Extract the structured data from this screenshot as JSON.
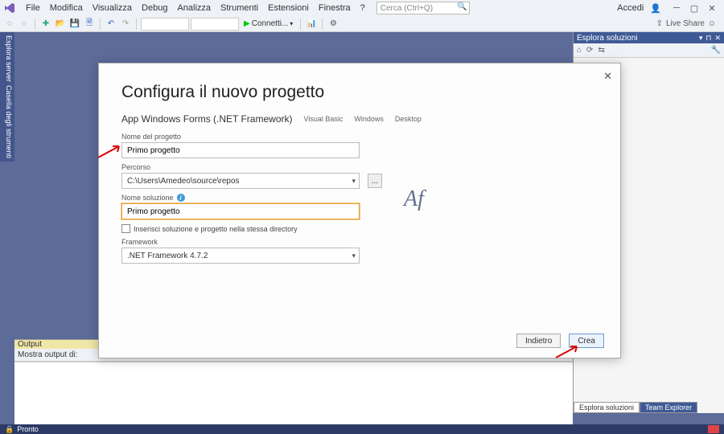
{
  "menu": {
    "items": [
      "File",
      "Modifica",
      "Visualizza",
      "Debug",
      "Analizza",
      "Strumenti",
      "Estensioni",
      "Finestra",
      "?"
    ],
    "search_placeholder": "Cerca (Ctrl+Q)",
    "accedi": "Accedi"
  },
  "toolbar": {
    "connect": "Connetti...",
    "liveshare": "Live Share"
  },
  "side_tabs": {
    "a": "Esplora server",
    "b": "Casella degli strumenti"
  },
  "solution": {
    "title": "Esplora soluzioni",
    "tabs": {
      "active": "Esplora soluzioni",
      "other": "Team Explorer"
    }
  },
  "output": {
    "title": "Output",
    "label": "Mostra output di:"
  },
  "status": {
    "ready": "Pronto"
  },
  "dialog": {
    "title": "Configura il nuovo progetto",
    "subtitle": "App Windows Forms (.NET Framework)",
    "tags": [
      "Visual Basic",
      "Windows",
      "Desktop"
    ],
    "labels": {
      "project_name": "Nome del progetto",
      "location": "Percorso",
      "solution_name": "Nome soluzione",
      "framework": "Framework"
    },
    "values": {
      "project_name": "Primo progetto",
      "location": "C:\\Users\\Amedeo\\source\\repos",
      "solution_name": "Primo progetto",
      "framework": ".NET Framework 4.7.2"
    },
    "checkbox": "Inserisci soluzione e progetto nella stessa directory",
    "browse": "...",
    "back": "Indietro",
    "create": "Crea"
  },
  "watermark": "Af"
}
